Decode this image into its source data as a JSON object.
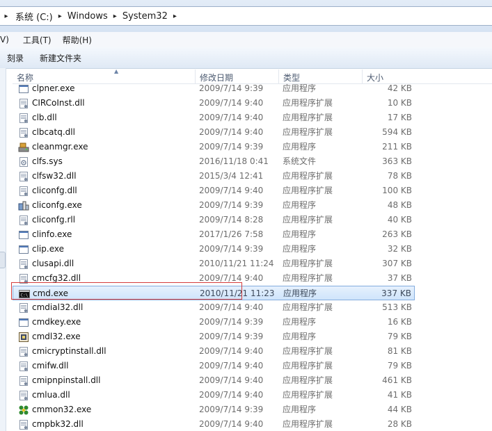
{
  "address": {
    "crumbs": [
      "系统 (C:)",
      "Windows",
      "System32"
    ],
    "separator": "▸"
  },
  "menu": {
    "partial_view": "V)",
    "tools": "工具(T)",
    "help": "帮助(H)"
  },
  "toolbar": {
    "burn": "刻录",
    "new_folder": "新建文件夹"
  },
  "columns": {
    "name": "名称",
    "date": "修改日期",
    "type": "类型",
    "size": "大小"
  },
  "files": [
    {
      "name": "clpner.exe",
      "date": "2009/7/14 9:39",
      "type": "应用程序",
      "size": "42 KB",
      "icon": "exe-window-icon"
    },
    {
      "name": "CIRCoInst.dll",
      "date": "2009/7/14 9:40",
      "type": "应用程序扩展",
      "size": "10 KB",
      "icon": "dll-icon"
    },
    {
      "name": "clb.dll",
      "date": "2009/7/14 9:40",
      "type": "应用程序扩展",
      "size": "17 KB",
      "icon": "dll-icon"
    },
    {
      "name": "clbcatq.dll",
      "date": "2009/7/14 9:40",
      "type": "应用程序扩展",
      "size": "594 KB",
      "icon": "dll-icon"
    },
    {
      "name": "cleanmgr.exe",
      "date": "2009/7/14 9:39",
      "type": "应用程序",
      "size": "211 KB",
      "icon": "disk-cleanup-icon"
    },
    {
      "name": "clfs.sys",
      "date": "2016/11/18 0:41",
      "type": "系统文件",
      "size": "363 KB",
      "icon": "sys-file-icon"
    },
    {
      "name": "clfsw32.dll",
      "date": "2015/3/4 12:41",
      "type": "应用程序扩展",
      "size": "78 KB",
      "icon": "dll-icon"
    },
    {
      "name": "cliconfg.dll",
      "date": "2009/7/14 9:40",
      "type": "应用程序扩展",
      "size": "100 KB",
      "icon": "dll-icon"
    },
    {
      "name": "cliconfg.exe",
      "date": "2009/7/14 9:39",
      "type": "应用程序",
      "size": "48 KB",
      "icon": "cliconfg-app-icon"
    },
    {
      "name": "cliconfg.rll",
      "date": "2009/7/14 8:28",
      "type": "应用程序扩展",
      "size": "40 KB",
      "icon": "dll-icon"
    },
    {
      "name": "clinfo.exe",
      "date": "2017/1/26 7:58",
      "type": "应用程序",
      "size": "263 KB",
      "icon": "exe-window-icon"
    },
    {
      "name": "clip.exe",
      "date": "2009/7/14 9:39",
      "type": "应用程序",
      "size": "32 KB",
      "icon": "exe-window-icon"
    },
    {
      "name": "clusapi.dll",
      "date": "2010/11/21 11:24",
      "type": "应用程序扩展",
      "size": "307 KB",
      "icon": "dll-icon"
    },
    {
      "name": "cmcfg32.dll",
      "date": "2009/7/14 9:40",
      "type": "应用程序扩展",
      "size": "37 KB",
      "icon": "dll-icon"
    },
    {
      "name": "cmd.exe",
      "date": "2010/11/21 11:23",
      "type": "应用程序",
      "size": "337 KB",
      "icon": "cmd-console-icon"
    },
    {
      "name": "cmdial32.dll",
      "date": "2009/7/14 9:40",
      "type": "应用程序扩展",
      "size": "513 KB",
      "icon": "dll-icon"
    },
    {
      "name": "cmdkey.exe",
      "date": "2009/7/14 9:39",
      "type": "应用程序",
      "size": "16 KB",
      "icon": "exe-window-icon"
    },
    {
      "name": "cmdl32.exe",
      "date": "2009/7/14 9:39",
      "type": "应用程序",
      "size": "79 KB",
      "icon": "cmdl-app-icon"
    },
    {
      "name": "cmicryptinstall.dll",
      "date": "2009/7/14 9:40",
      "type": "应用程序扩展",
      "size": "81 KB",
      "icon": "dll-icon"
    },
    {
      "name": "cmifw.dll",
      "date": "2009/7/14 9:40",
      "type": "应用程序扩展",
      "size": "79 KB",
      "icon": "dll-icon"
    },
    {
      "name": "cmipnpinstall.dll",
      "date": "2009/7/14 9:40",
      "type": "应用程序扩展",
      "size": "461 KB",
      "icon": "dll-icon"
    },
    {
      "name": "cmlua.dll",
      "date": "2009/7/14 9:40",
      "type": "应用程序扩展",
      "size": "41 KB",
      "icon": "dll-icon"
    },
    {
      "name": "cmmon32.exe",
      "date": "2009/7/14 9:39",
      "type": "应用程序",
      "size": "44 KB",
      "icon": "cmmon-app-icon"
    },
    {
      "name": "cmpbk32.dll",
      "date": "2009/7/14 9:40",
      "type": "应用程序扩展",
      "size": "28 KB",
      "icon": "dll-icon"
    }
  ],
  "selected_file": "cmd.exe",
  "colors": {
    "selection_border": "#84acdd",
    "highlight_annotation": "#d43b3b"
  }
}
